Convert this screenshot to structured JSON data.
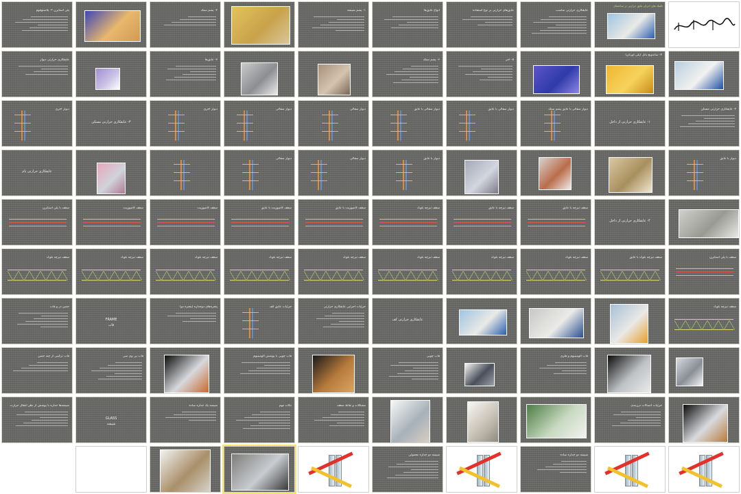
{
  "slides": [
    {
      "n": 1,
      "kind": "calligraphy",
      "text": "بسم الله الرحمن الرحیم"
    },
    {
      "n": 2,
      "kind": "photo",
      "header": "تكنیك های اجرای عایق حرارتی در ساختمان",
      "photo": "worker-insulation"
    },
    {
      "n": 3,
      "kind": "text",
      "title": "عایقکاری حرارتی مناسب"
    },
    {
      "n": 4,
      "kind": "text",
      "title": "عایق‌های حرارتی بر نوع استفاده"
    },
    {
      "n": 5,
      "kind": "text",
      "title": "انواع عایق‌ها"
    },
    {
      "n": 6,
      "kind": "text",
      "title": "۱- پشم شیشه"
    },
    {
      "n": 7,
      "kind": "photo",
      "photo": "glasswool-rolls"
    },
    {
      "n": 8,
      "kind": "text",
      "title": "۲- پشم سنگ"
    },
    {
      "n": 9,
      "kind": "photo",
      "photo": "blocks"
    },
    {
      "n": 10,
      "kind": "text",
      "title": "پلی استایرن ۳- پلاستوفوم"
    },
    {
      "n": 11,
      "kind": "photo",
      "photo": "worker-roof"
    },
    {
      "n": 12,
      "kind": "photo",
      "title": "۴- ساندویچ پانل (پلی اورتان)",
      "photo": "yellow-panel"
    },
    {
      "n": 13,
      "kind": "photo",
      "photo": "blue-panel"
    },
    {
      "n": 14,
      "kind": "text",
      "title": "۵- آجر"
    },
    {
      "n": 15,
      "kind": "text",
      "title": "۶- پشم سنگ"
    },
    {
      "n": 16,
      "kind": "photo",
      "photo": "perforated-brick"
    },
    {
      "n": 17,
      "kind": "photo",
      "photo": "worker-hands"
    },
    {
      "n": 18,
      "kind": "text",
      "title": "۷- عایق‌ها"
    },
    {
      "n": 19,
      "kind": "photo",
      "title": "",
      "photo": "purple-foam"
    },
    {
      "n": 20,
      "kind": "text",
      "title": "عایقکاری حرارتی دیوار"
    },
    {
      "n": 21,
      "kind": "text",
      "title": "۲- عایقکاری حرارتی مسکن"
    },
    {
      "n": 22,
      "kind": "text",
      "title": "۱- عایقکاری حرارتی از داخل",
      "center": true
    },
    {
      "n": 23,
      "kind": "drawing",
      "title": "دیوار سفالی با عایق پشم سنگ"
    },
    {
      "n": 24,
      "kind": "drawing",
      "title": "دیوار سفالی با عایق"
    },
    {
      "n": 25,
      "kind": "drawing",
      "title": "دیوار سفالی با عایق"
    },
    {
      "n": 26,
      "kind": "drawing",
      "title": "دیوار سفالی"
    },
    {
      "n": 27,
      "kind": "drawing",
      "title": "دیوار سفالی"
    },
    {
      "n": 28,
      "kind": "drawing",
      "title": "دیوار آجری"
    },
    {
      "n": 29,
      "kind": "text",
      "title": "۳- عایقکاری حرارتی مسکن",
      "center": true
    },
    {
      "n": 30,
      "kind": "drawing",
      "title": "دیوار آجری"
    },
    {
      "n": 31,
      "kind": "drawing",
      "title": "دیوار با عایق"
    },
    {
      "n": 32,
      "kind": "photo",
      "photo": "installer"
    },
    {
      "n": 33,
      "kind": "photo",
      "photo": "room-wall"
    },
    {
      "n": 34,
      "kind": "photo",
      "photo": "interior"
    },
    {
      "n": 35,
      "kind": "drawing",
      "title": "دیوار با عایق"
    },
    {
      "n": 36,
      "kind": "drawing",
      "title": "دیوار سفالی"
    },
    {
      "n": 37,
      "kind": "drawing",
      "title": "دیوار سفالی"
    },
    {
      "n": 38,
      "kind": "drawing",
      "title": ""
    },
    {
      "n": 39,
      "kind": "photo",
      "photo": "mesh-panel"
    },
    {
      "n": 40,
      "kind": "text",
      "title": "عایقکاری حرارتی بام",
      "center": true
    },
    {
      "n": 41,
      "kind": "photo",
      "photo": "roof-section"
    },
    {
      "n": 42,
      "kind": "text",
      "title": "۴- عایقکاری حرارتی از داخل",
      "center": true
    },
    {
      "n": 43,
      "kind": "section",
      "title": "سقف تیرچه با عایق"
    },
    {
      "n": 44,
      "kind": "section",
      "title": "سقف تیرچه با عایق"
    },
    {
      "n": 45,
      "kind": "section",
      "title": "سقف تیرچه بلوک"
    },
    {
      "n": 46,
      "kind": "section",
      "title": "سقف کامپوزیت با عایق"
    },
    {
      "n": 47,
      "kind": "section",
      "title": "سقف کامپوزیت با عایق"
    },
    {
      "n": 48,
      "kind": "section",
      "title": "سقف کامپوزیت"
    },
    {
      "n": 49,
      "kind": "section",
      "title": "سقف کامپوزیت"
    },
    {
      "n": 50,
      "kind": "section",
      "title": "سقف با پلی استایرن"
    },
    {
      "n": 51,
      "kind": "section",
      "title": "سقف با پلی استایرن"
    },
    {
      "n": 52,
      "kind": "truss",
      "title": "سقف تیرچه بلوک با عایق"
    },
    {
      "n": 53,
      "kind": "truss",
      "title": "سقف تیرچه بلوک"
    },
    {
      "n": 54,
      "kind": "truss",
      "title": "سقف تیرچه بلوک"
    },
    {
      "n": 55,
      "kind": "truss",
      "title": "سقف تیرچه بلوک"
    },
    {
      "n": 56,
      "kind": "truss",
      "title": "سقف تیرچه بلوک"
    },
    {
      "n": 57,
      "kind": "truss",
      "title": "سقف تیرچه بلوک"
    },
    {
      "n": 58,
      "kind": "truss",
      "title": "سقف تیرچه بلوک"
    },
    {
      "n": 59,
      "kind": "truss",
      "title": "سقف تیرچه بلوک"
    },
    {
      "n": 60,
      "kind": "truss",
      "title": "سقف تیرچه بلوک"
    },
    {
      "n": 61,
      "kind": "truss",
      "title": "سقف تیرچه بلوک"
    },
    {
      "n": 62,
      "kind": "photo",
      "photo": "roof-workers"
    },
    {
      "n": 63,
      "kind": "photo",
      "photo": "roof-workers-2"
    },
    {
      "n": 64,
      "kind": "photo",
      "photo": "worker-insulation"
    },
    {
      "n": 65,
      "kind": "text",
      "title": "عایقکاری حرارتی کف",
      "center": true
    },
    {
      "n": 66,
      "kind": "text",
      "title": "جزئیات اجرایی عایقکاری حرارتی"
    },
    {
      "n": 67,
      "kind": "drawing",
      "title": "جزئیات عایق کف"
    },
    {
      "n": 68,
      "kind": "text",
      "title": "پنجره‌های دوجداره (پنجره دو)"
    },
    {
      "n": 69,
      "kind": "text",
      "title": "FRAME",
      "sub": "قاب",
      "center": true
    },
    {
      "n": 70,
      "kind": "text",
      "title": "جنس در و قاب"
    },
    {
      "n": 71,
      "kind": "photo",
      "photo": "window-profiles"
    },
    {
      "n": 72,
      "kind": "photo",
      "photo": "window-black"
    },
    {
      "n": 73,
      "kind": "text",
      "title": "قاب آلومینیوم و فلزی"
    },
    {
      "n": 74,
      "kind": "photo",
      "photo": "frame-section"
    },
    {
      "n": 75,
      "kind": "text",
      "title": "قاب چوبی"
    },
    {
      "n": 76,
      "kind": "photo",
      "photo": "wood-frame"
    },
    {
      "n": 77,
      "kind": "text",
      "title": "قاب چوبی با پوشش آلومینیوم"
    },
    {
      "n": 78,
      "kind": "photo",
      "photo": "window-black-2"
    },
    {
      "n": 79,
      "kind": "text",
      "title": "قاب پی وی سی"
    },
    {
      "n": 80,
      "kind": "text",
      "title": "قاب ترکیبی از چند جنس"
    },
    {
      "n": 81,
      "kind": "photo",
      "photo": "window-frame-3"
    },
    {
      "n": 82,
      "kind": "text",
      "title": "جزئیات اتصالات درزبندی"
    },
    {
      "n": 83,
      "kind": "photo",
      "photo": "green-frames"
    },
    {
      "n": 84,
      "kind": "photo",
      "photo": "catalog"
    },
    {
      "n": 85,
      "kind": "photo",
      "photo": "catalog-2"
    },
    {
      "n": 86,
      "kind": "text",
      "title": "مشکلات و نقاط ضعف"
    },
    {
      "n": 87,
      "kind": "text",
      "title": "نکات مهم"
    },
    {
      "n": 88,
      "kind": "text",
      "title": "شیشه یک جداره ساده"
    },
    {
      "n": 89,
      "kind": "text",
      "title": "GLASS",
      "sub": "شیشه",
      "center": true
    },
    {
      "n": 90,
      "kind": "text",
      "title": "شیشه‌ها جداره با پوشش از نظر انتقال حرارت"
    },
    {
      "n": 91,
      "kind": "glass",
      "title": ""
    },
    {
      "n": 92,
      "kind": "glass",
      "title": ""
    },
    {
      "n": 93,
      "kind": "text",
      "title": "شیشه دو جداره ساده"
    },
    {
      "n": 94,
      "kind": "glass",
      "title": ""
    },
    {
      "n": 95,
      "kind": "text",
      "title": "شیشه دو جداره معمولی"
    },
    {
      "n": 96,
      "kind": "glass",
      "title": ""
    },
    {
      "n": 97,
      "kind": "photo",
      "photo": "glass-units"
    },
    {
      "n": 98,
      "kind": "photo",
      "photo": "window-photo"
    },
    {
      "n": 99,
      "kind": "blank",
      "title": ""
    }
  ],
  "colors": {
    "slide_bg": "#686866",
    "accent": "#bfe07a",
    "text": "#f2f2f2",
    "page_bg": "#ffffff"
  }
}
